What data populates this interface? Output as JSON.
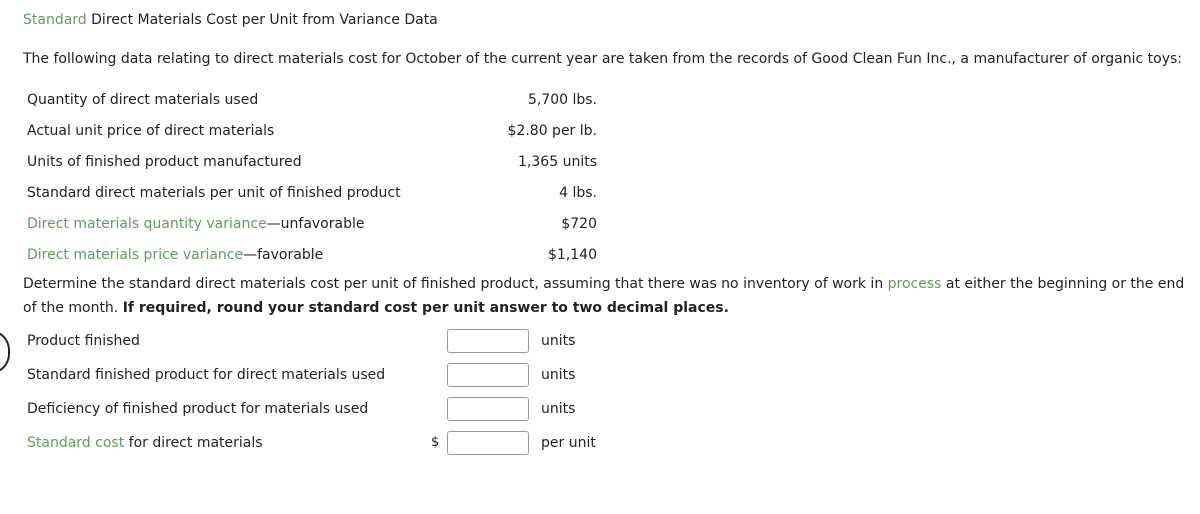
{
  "title": {
    "highlight": "Standard",
    "rest": " Direct Materials Cost per Unit from Variance Data"
  },
  "intro": "The following data relating to direct materials cost for October of the current year are taken from the records of Good Clean Fun Inc., a manufacturer of organic toys:",
  "data_rows": [
    {
      "label": "Quantity of direct materials used",
      "value": "5,700 lbs."
    },
    {
      "label": "Actual unit price of direct materials",
      "value": "$2.80 per lb."
    },
    {
      "label": "Units of finished product manufactured",
      "value": "1,365 units"
    },
    {
      "label": "Standard direct materials per unit of finished product",
      "value": "4 lbs."
    },
    {
      "label_highlight": "Direct materials quantity variance",
      "label_rest": "—unfavorable",
      "value": "$720"
    },
    {
      "label_highlight": "Direct materials price variance",
      "label_rest": "—favorable",
      "value": "$1,140"
    }
  ],
  "question": {
    "part1": "Determine the standard direct materials cost per unit of finished product, assuming that there was no inventory of work in ",
    "highlight": "process",
    "part2": " at either the beginning or the end of the month. ",
    "bold": "If required, round your standard cost per unit answer to two decimal places."
  },
  "answers": [
    {
      "label": "Product finished",
      "prefix": "",
      "value": "",
      "unit": "units"
    },
    {
      "label": "Standard finished product for direct materials used",
      "prefix": "",
      "value": "",
      "unit": "units"
    },
    {
      "label": "Deficiency of finished product for materials used",
      "prefix": "",
      "value": "",
      "unit": "units"
    },
    {
      "label_highlight": "Standard cost",
      "label_rest": " for direct materials",
      "prefix": "$",
      "value": "",
      "unit": "per unit"
    }
  ],
  "colors": {
    "accent_green": "#5aa05a",
    "text": "#222222"
  }
}
